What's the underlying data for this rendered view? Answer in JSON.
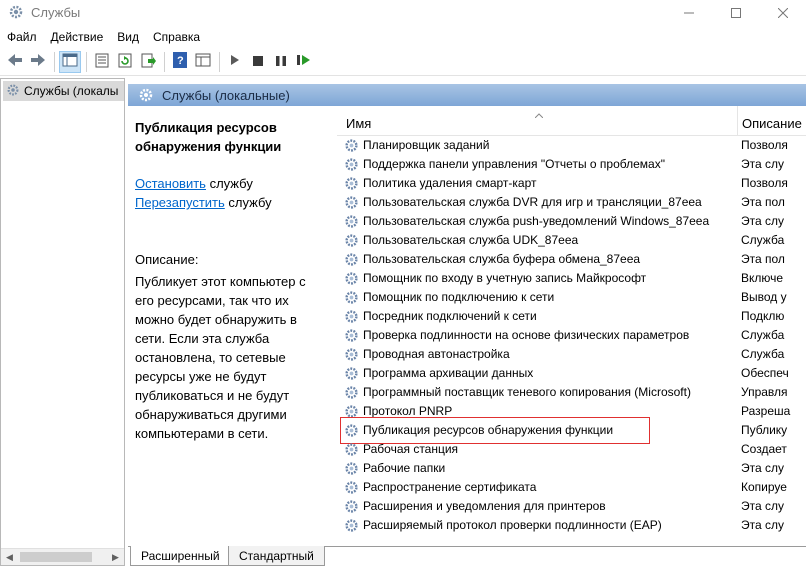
{
  "window": {
    "title": "Службы"
  },
  "menu": [
    "Файл",
    "Действие",
    "Вид",
    "Справка"
  ],
  "tree": {
    "root_label": "Службы (локалы"
  },
  "header": {
    "title": "Службы (локальные)"
  },
  "details": {
    "service_title": "Публикация ресурсов обнаружения функции",
    "stop_link": "Остановить",
    "stop_suffix": " службу",
    "restart_link": "Перезапустить",
    "restart_suffix": " службу",
    "description_label": "Описание:",
    "description_text": "Публикует этот компьютер с его ресурсами, так что их можно будет обнаружить в сети.  Если эта служба остановлена, то сетевые ресурсы уже не будут публиковаться и не будут обнаруживаться другими компьютерами в сети."
  },
  "list": {
    "col_name": "Имя",
    "col_desc": "Описание",
    "rows": [
      {
        "name": "Планировщик заданий",
        "desc": "Позволя"
      },
      {
        "name": "Поддержка панели управления \"Отчеты о проблемах\"",
        "desc": "Эта слу"
      },
      {
        "name": "Политика удаления смарт-карт",
        "desc": "Позволя"
      },
      {
        "name": "Пользовательская служба DVR для игр и трансляции_87eea",
        "desc": "Эта пол"
      },
      {
        "name": "Пользовательская служба push-уведомлений Windows_87eea",
        "desc": "Эта слу"
      },
      {
        "name": "Пользовательская служба UDK_87eea",
        "desc": "Служба"
      },
      {
        "name": "Пользовательская служба буфера обмена_87eea",
        "desc": "Эта пол"
      },
      {
        "name": "Помощник по входу в учетную запись Майкрософт",
        "desc": "Включе"
      },
      {
        "name": "Помощник по подключению к сети",
        "desc": "Вывод у"
      },
      {
        "name": "Посредник подключений к сети",
        "desc": "Подклю"
      },
      {
        "name": "Проверка подлинности на основе физических параметров",
        "desc": "Служба"
      },
      {
        "name": "Проводная автонастройка",
        "desc": "Служба"
      },
      {
        "name": "Программа архивации данных",
        "desc": "Обеспеч"
      },
      {
        "name": "Программный поставщик теневого копирования (Microsoft)",
        "desc": "Управля"
      },
      {
        "name": "Протокол PNRP",
        "desc": "Разреша"
      },
      {
        "name": "Публикация ресурсов обнаружения функции",
        "desc": "Публику",
        "selected": true
      },
      {
        "name": "Рабочая станция",
        "desc": "Создает"
      },
      {
        "name": "Рабочие папки",
        "desc": "Эта слу"
      },
      {
        "name": "Распространение сертификата",
        "desc": "Копируе"
      },
      {
        "name": "Расширения и уведомления для принтеров",
        "desc": "Эта слу"
      },
      {
        "name": "Расширяемый протокол проверки подлинности (EAP)",
        "desc": "Эта слу"
      }
    ]
  },
  "tabs": {
    "extended": "Расширенный",
    "standard": "Стандартный"
  },
  "colors": {
    "header_band": "#8fb2dc",
    "link": "#0066cc",
    "selection_outline": "#e03030"
  },
  "icons": [
    "back-arrow-icon",
    "forward-arrow-icon",
    "console-tree-icon",
    "properties-icon",
    "refresh-icon",
    "export-icon",
    "help-icon",
    "view-icon",
    "play-icon",
    "stop-icon",
    "pause-icon",
    "restart-icon",
    "gear-icon"
  ]
}
